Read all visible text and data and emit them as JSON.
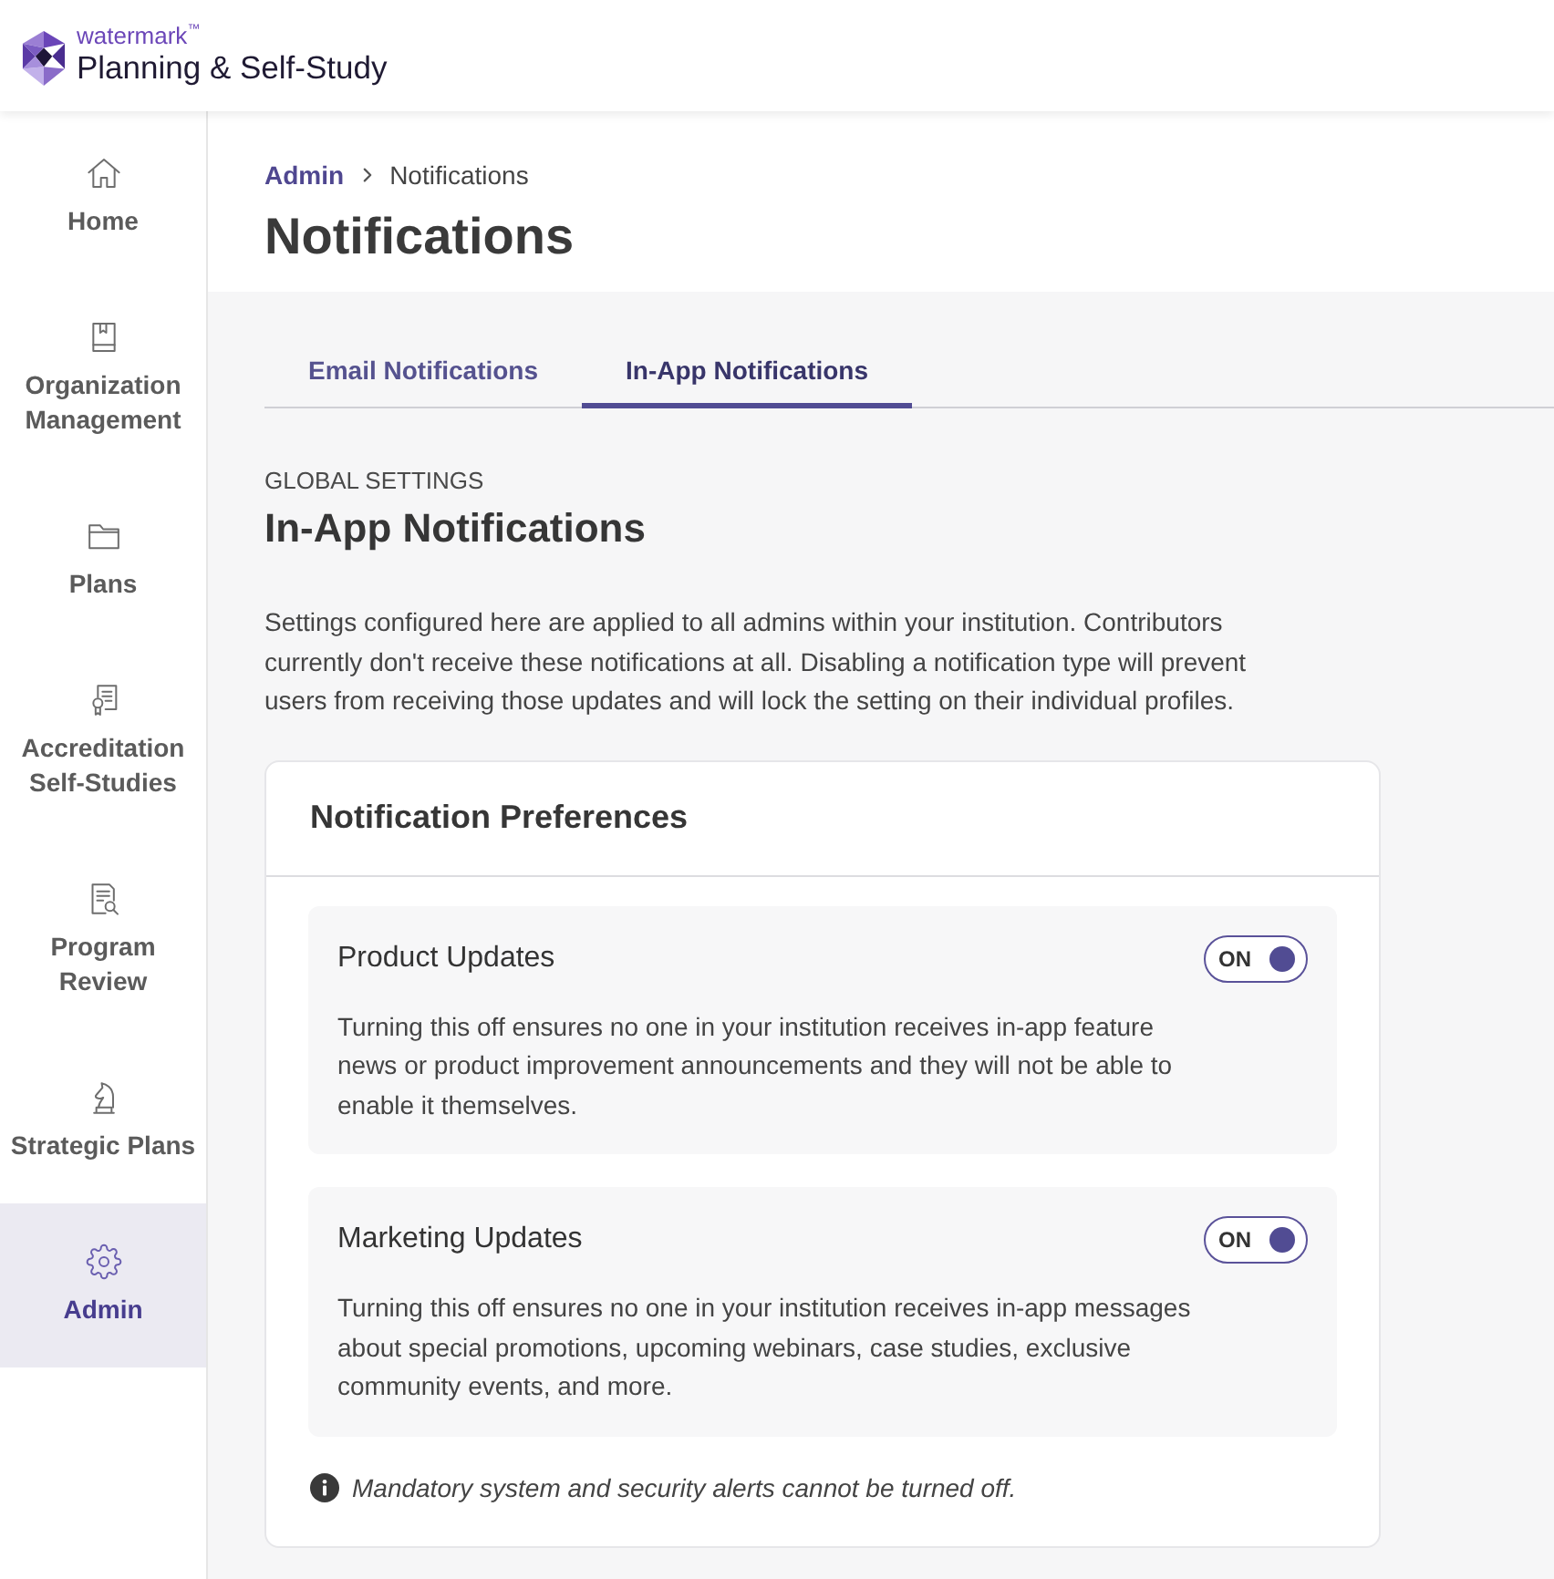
{
  "header": {
    "brand": "watermark$^{™}$",
    "product": "Planning & Self-Study"
  },
  "sidebar": {
    "items": [
      {
        "label": "Home",
        "selected": false
      },
      {
        "label": "Organization Management",
        "selected": false
      },
      {
        "label": "Plans",
        "selected": false
      },
      {
        "label": "Accreditation Self-Studies",
        "selected": false
      },
      {
        "label": "Program Review",
        "selected": false
      },
      {
        "label": "Strategic Plans",
        "selected": false
      },
      {
        "label": "Admin",
        "selected": true
      }
    ]
  },
  "breadcrumb": [
    {
      "label": "Admin",
      "kind": "link"
    },
    {
      "label": "Notifications",
      "kind": "current"
    }
  ],
  "page_title": "Notifications",
  "tabs": [
    {
      "label": "Email Notifications",
      "selected": false
    },
    {
      "label": "In-App Notifications",
      "selected": true
    }
  ],
  "global_settings": {
    "overline": "GLOBAL SETTINGS",
    "title": "In-App Notifications",
    "description": "Settings configured here are applied to all admins within your institution. Contributors currently don't receive these notifications at all. Disabling a notification type will prevent users from receiving those updates and will lock the setting on their individual profiles."
  },
  "preferences": {
    "title": "Notification Preferences",
    "items": [
      {
        "title": "Product Updates",
        "description": "Turning this off ensures no one in your institution receives in-app feature news or product improvement announcements and they will not be able to enable it themselves.",
        "on": true,
        "toggle_label": "ON"
      },
      {
        "title": "Marketing Updates",
        "description": "Turning this off ensures no one in your institution receives in-app messages about special promotions, upcoming webinars, case studies, exclusive community events, and more.",
        "on": true,
        "toggle_label": "ON"
      }
    ],
    "note": "Mandatory system and security alerts cannot be turned off."
  }
}
